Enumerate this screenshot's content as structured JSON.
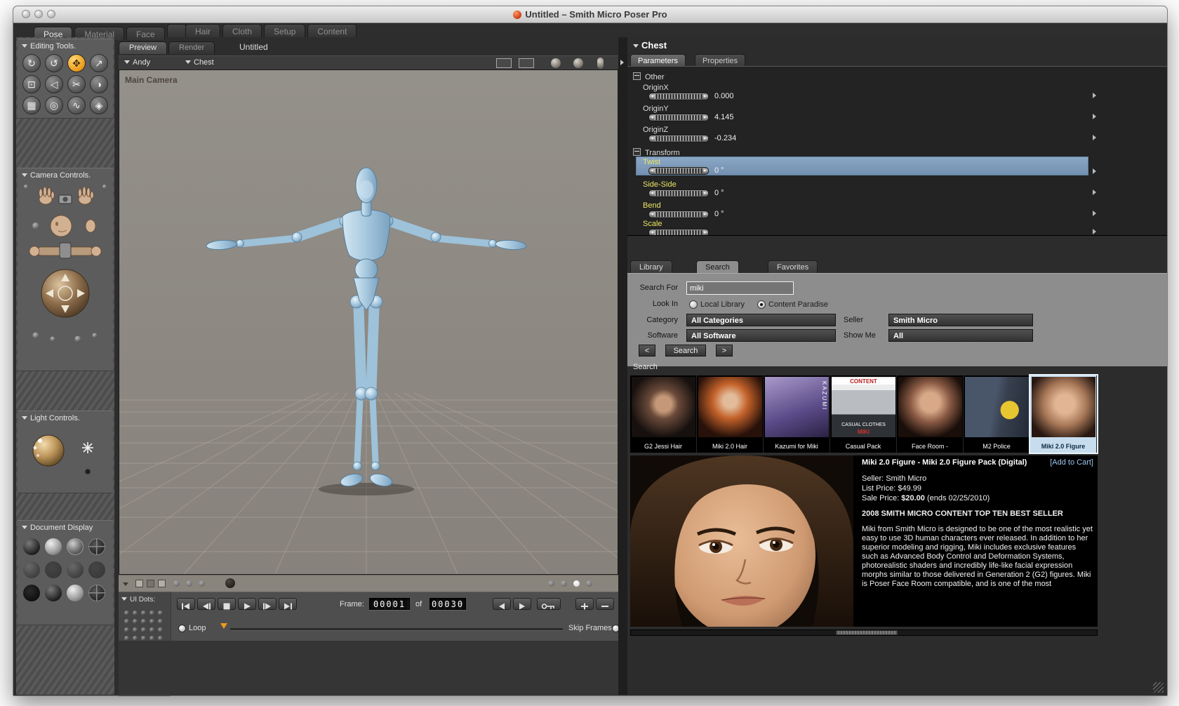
{
  "window": {
    "title": "Untitled – Smith Micro Poser Pro"
  },
  "room_tabs": [
    {
      "label": "Pose",
      "active": true
    },
    {
      "label": "Material",
      "active": false
    },
    {
      "label": "Face",
      "active": false
    },
    {
      "label": "Hair",
      "active": false
    },
    {
      "label": "Cloth",
      "active": false
    },
    {
      "label": "Setup",
      "active": false
    },
    {
      "label": "Content",
      "active": false
    }
  ],
  "left_panel": {
    "editing_tools": {
      "label": "Editing Tools.",
      "tools": [
        {
          "name": "rotate",
          "glyph": "↻"
        },
        {
          "name": "twist",
          "glyph": "↺"
        },
        {
          "name": "translate-pull",
          "glyph": "✥",
          "selected": true
        },
        {
          "name": "translate-in-out",
          "glyph": "↗"
        },
        {
          "name": "scale",
          "glyph": "⊡"
        },
        {
          "name": "taper",
          "glyph": "◁"
        },
        {
          "name": "chain-break",
          "glyph": "✂"
        },
        {
          "name": "color",
          "glyph": "◑"
        },
        {
          "name": "grouping",
          "glyph": "▦"
        },
        {
          "name": "view-magnifier",
          "glyph": "◎"
        },
        {
          "name": "morphing",
          "glyph": "∿"
        },
        {
          "name": "direct-manipulation",
          "glyph": "◈"
        }
      ]
    },
    "camera_controls": {
      "label": "Camera Controls."
    },
    "light_controls": {
      "label": "Light Controls."
    },
    "document_display": {
      "label": "Document Display"
    }
  },
  "viewport": {
    "tabs": [
      {
        "label": "Preview",
        "active": true
      },
      {
        "label": "Render",
        "active": false
      }
    ],
    "document_title": "Untitled",
    "figure_menu": "Andy",
    "actor_menu": "Chest",
    "camera_name": "Main Camera"
  },
  "timeline": {
    "ui_dots_label": "UI Dots:",
    "frame_label": "Frame:",
    "current_frame": "00001",
    "of_label": "of",
    "total_frames": "00030",
    "loop_label": "Loop",
    "skip_frames_label": "Skip Frames"
  },
  "parameters_panel": {
    "header": "Chest",
    "tabs": [
      {
        "label": "Parameters",
        "active": true
      },
      {
        "label": "Properties",
        "active": false
      }
    ],
    "group_other": "Other",
    "group_transform": "Transform",
    "rows": [
      {
        "label": "OriginX",
        "value": "0.000"
      },
      {
        "label": "OriginY",
        "value": "4.145"
      },
      {
        "label": "OriginZ",
        "value": "-0.234"
      },
      {
        "label": "Twist",
        "value": "0 °",
        "highlighted": true
      },
      {
        "label": "Side-Side",
        "value": "0 °"
      },
      {
        "label": "Bend",
        "value": "0 °"
      },
      {
        "label": "Scale",
        "value": ""
      }
    ]
  },
  "library_panel": {
    "tabs": [
      {
        "label": "Library",
        "active": false
      },
      {
        "label": "Search",
        "active": true
      },
      {
        "label": "Favorites",
        "active": false
      }
    ],
    "form": {
      "search_for_label": "Search For",
      "search_value": "miki",
      "look_in_label": "Look In",
      "local_library_label": "Local Library",
      "content_paradise_label": "Content Paradise",
      "category_label": "Category",
      "category_value": "All Categories",
      "seller_label": "Seller",
      "seller_value": "Smith Micro",
      "software_label": "Software",
      "software_value": "All Software",
      "show_me_label": "Show Me",
      "show_me_value": "All",
      "prev_button": "<",
      "search_button": "Search",
      "next_button": ">"
    },
    "results_label": "Search",
    "thumbnails": [
      {
        "caption": "G2 Jessi Hair"
      },
      {
        "caption": "Miki 2.0 Hair"
      },
      {
        "caption": "Kazumi for Miki",
        "overlay": "KAZUMI"
      },
      {
        "caption": "Casual Pack",
        "overlay_top": "CONTENT",
        "overlay_mid": "CASUAL CLOTHES",
        "overlay_bottom": "MIKI"
      },
      {
        "caption": "Face Room -"
      },
      {
        "caption": "M2 Police"
      },
      {
        "caption": "Miki 2.0 Figure",
        "selected": true
      }
    ],
    "detail": {
      "title": "Miki 2.0 Figure - Miki 2.0 Figure Pack (Digital)",
      "add_to_cart": "[Add to Cart]",
      "seller": "Seller: Smith Micro",
      "list_price": "List Price: $49.99",
      "sale_price_label": "Sale Price: ",
      "sale_price_value": "$20.00",
      "sale_price_note": " (ends 02/25/2010)",
      "best_seller_line": "2008 SMITH MICRO CONTENT TOP TEN BEST SELLER",
      "description": "Miki from Smith Micro is designed to be one of the most realistic yet easy to use 3D human characters ever released. In addition to her superior modeling and rigging, Miki includes exclusive features such as Advanced Body Control and Deformation Systems, photorealistic shaders and incredibly life-like facial expression morphs similar to those delivered in Generation 2 (G2) figures. Miki is Poser Face Room compatible, and is one of the most"
    }
  },
  "colors": {
    "highlight_row": "#7d98b8",
    "param_label_yellow": "#e9e465",
    "selected_tool_orange": "#e8920e",
    "add_to_cart_blue": "#9cc6ee"
  }
}
